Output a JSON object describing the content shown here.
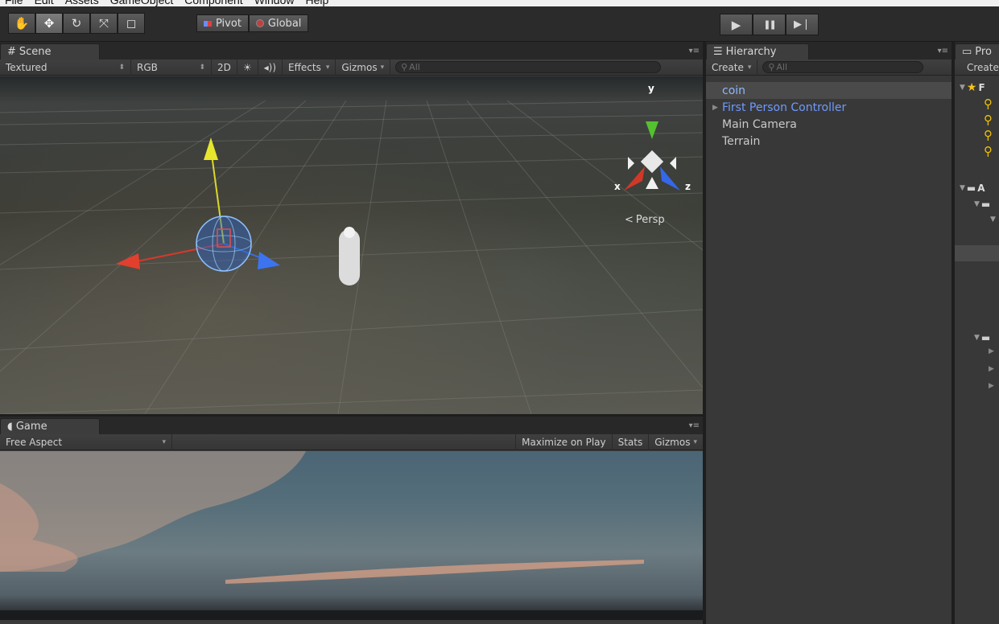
{
  "menu": {
    "items": [
      "File",
      "Edit",
      "Assets",
      "GameObject",
      "Component",
      "Window",
      "Help"
    ]
  },
  "toolbar": {
    "tools": [
      {
        "name": "hand-tool-button",
        "glyph": "✋",
        "active": false
      },
      {
        "name": "move-tool-button",
        "glyph": "✥",
        "active": true
      },
      {
        "name": "rotate-tool-button",
        "glyph": "↻",
        "active": false
      },
      {
        "name": "scale-tool-button",
        "glyph": "⤧",
        "active": false
      },
      {
        "name": "rect-tool-button",
        "glyph": "◻",
        "active": false
      }
    ],
    "pivot_label": "Pivot",
    "global_label": "Global",
    "play_glyph": "▶",
    "pause_glyph": "❚❚",
    "step_glyph": "▶❘"
  },
  "scene": {
    "tab_label": "Scene",
    "shading": "Textured",
    "render_mode": "RGB",
    "mode_2d": "2D",
    "effects": "Effects",
    "gizmos": "Gizmos",
    "search_placeholder": "All",
    "axis_y": "y",
    "axis_x": "x",
    "axis_z": "z",
    "projection": "Persp"
  },
  "game": {
    "tab_label": "Game",
    "aspect": "Free Aspect",
    "maximize_on_play": "Maximize on Play",
    "stats": "Stats",
    "gizmos": "Gizmos"
  },
  "hierarchy": {
    "tab_label": "Hierarchy",
    "create_label": "Create",
    "search_placeholder": "All",
    "items": [
      {
        "label": "coin",
        "selected": true
      },
      {
        "label": "First Person Controller",
        "expandable": true
      },
      {
        "label": "Main Camera"
      },
      {
        "label": "Terrain"
      }
    ]
  },
  "project": {
    "tab_label": "Pro",
    "create_label": "Create",
    "favorites_label": "F",
    "assets_label": "A"
  },
  "colors": {
    "selection_text": "#8fb7ff",
    "prefab_text": "#6f9aff",
    "favorite_star": "#f5c518",
    "search_icon": "#f0c000"
  }
}
